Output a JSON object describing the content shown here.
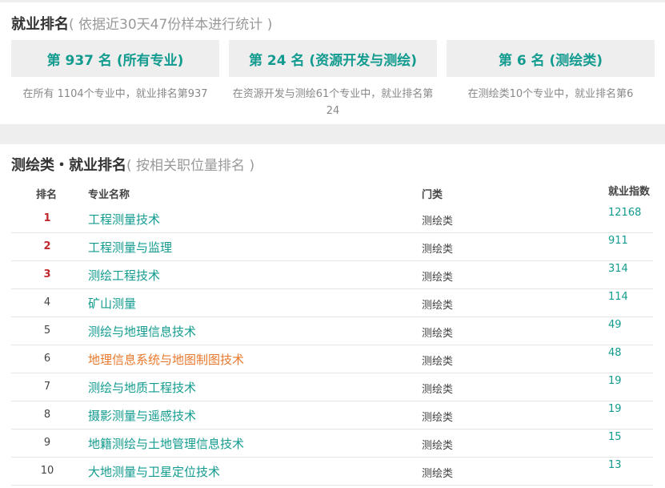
{
  "ranking": {
    "title": "就业排名",
    "subtitle": "( 依据近30天47份样本进行统计 )",
    "boxes": [
      {
        "label": "第 937 名 (所有专业)",
        "desc": "在所有 1104个专业中，就业排名第937"
      },
      {
        "label": "第 24 名 (资源开发与测绘)",
        "desc": "在资源开发与测绘61个专业中，就业排名第24"
      },
      {
        "label": "第 6 名 (测绘类)",
        "desc": "在测绘类10个专业中，就业排名第6"
      }
    ]
  },
  "category_ranking": {
    "title": "测绘类・就业排名",
    "subtitle": "( 按相关职位量排名 )",
    "headers": {
      "rank": "排名",
      "name": "专业名称",
      "category": "门类",
      "index": "就业指数"
    },
    "rows": [
      {
        "rank": "1",
        "name": "工程测量技术",
        "category": "测绘类",
        "index": "12168"
      },
      {
        "rank": "2",
        "name": "工程测量与监理",
        "category": "测绘类",
        "index": "911"
      },
      {
        "rank": "3",
        "name": "测绘工程技术",
        "category": "测绘类",
        "index": "314"
      },
      {
        "rank": "4",
        "name": "矿山测量",
        "category": "测绘类",
        "index": "114"
      },
      {
        "rank": "5",
        "name": "测绘与地理信息技术",
        "category": "测绘类",
        "index": "49"
      },
      {
        "rank": "6",
        "name": "地理信息系统与地图制图技术",
        "category": "测绘类",
        "index": "48"
      },
      {
        "rank": "7",
        "name": "测绘与地质工程技术",
        "category": "测绘类",
        "index": "19"
      },
      {
        "rank": "8",
        "name": "摄影测量与遥感技术",
        "category": "测绘类",
        "index": "19"
      },
      {
        "rank": "9",
        "name": "地籍测绘与土地管理信息技术",
        "category": "测绘类",
        "index": "15"
      },
      {
        "rank": "10",
        "name": "大地测量与卫星定位技术",
        "category": "测绘类",
        "index": "13"
      }
    ]
  },
  "colors": {
    "accent": "#129b8f",
    "top_rank": "#c0282d",
    "highlight": "#e8782b"
  }
}
